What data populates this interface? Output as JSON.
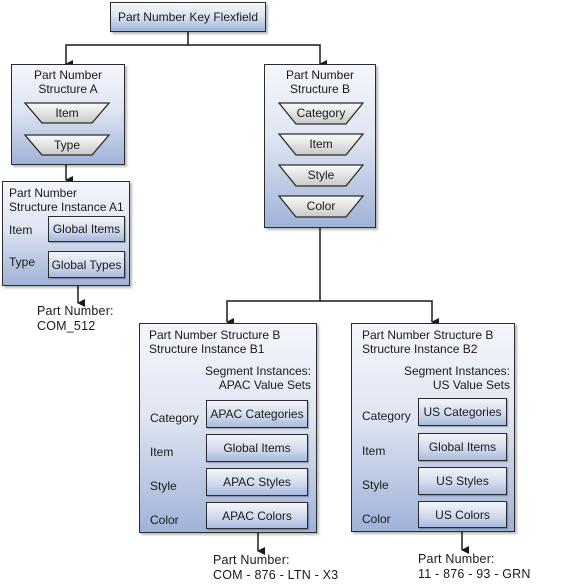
{
  "root": {
    "title": "Part Number Key Flexfield"
  },
  "structure_a": {
    "title_line1": "Part Number",
    "title_line2": "Structure A",
    "segments": [
      "Item",
      "Type"
    ]
  },
  "structure_b": {
    "title_line1": "Part Number",
    "title_line2": "Structure B",
    "segments": [
      "Category",
      "Item",
      "Style",
      "Color"
    ]
  },
  "instance_a1": {
    "title_line1": "Part Number",
    "title_line2": "Structure Instance A1",
    "rows": [
      {
        "segment": "Item",
        "value_set": "Global Items"
      },
      {
        "segment": "Type",
        "value_set": "Global Types"
      }
    ],
    "part_number_label": "Part Number:",
    "part_number_value": "COM_512"
  },
  "instance_b1": {
    "title_line1": "Part Number Structure B",
    "title_line2": "Structure Instance B1",
    "segment_caption_line1": "Segment Instances:",
    "segment_caption_line2": "APAC Value Sets",
    "rows": [
      {
        "segment": "Category",
        "value_set": "APAC Categories"
      },
      {
        "segment": "Item",
        "value_set": "Global Items"
      },
      {
        "segment": "Style",
        "value_set": "APAC Styles"
      },
      {
        "segment": "Color",
        "value_set": "APAC Colors"
      }
    ],
    "part_number_label": "Part Number:",
    "part_number_value": "COM - 876 - LTN - X3"
  },
  "instance_b2": {
    "title_line1": "Part Number Structure B",
    "title_line2": "Structure Instance B2",
    "segment_caption_line1": "Segment Instances:",
    "segment_caption_line2": "US Value Sets",
    "rows": [
      {
        "segment": "Category",
        "value_set": "US Categories"
      },
      {
        "segment": "Item",
        "value_set": "Global Items"
      },
      {
        "segment": "Style",
        "value_set": "US Styles"
      },
      {
        "segment": "Color",
        "value_set": "US Colors"
      }
    ],
    "part_number_label": "Part Number:",
    "part_number_value": "11 - 876 - 93 - GRN"
  },
  "colors": {
    "box_top": "#f4f6fb",
    "box_bottom": "#9fb2d8",
    "border": "#2b2b2b",
    "connector": "#1a1a1a"
  }
}
